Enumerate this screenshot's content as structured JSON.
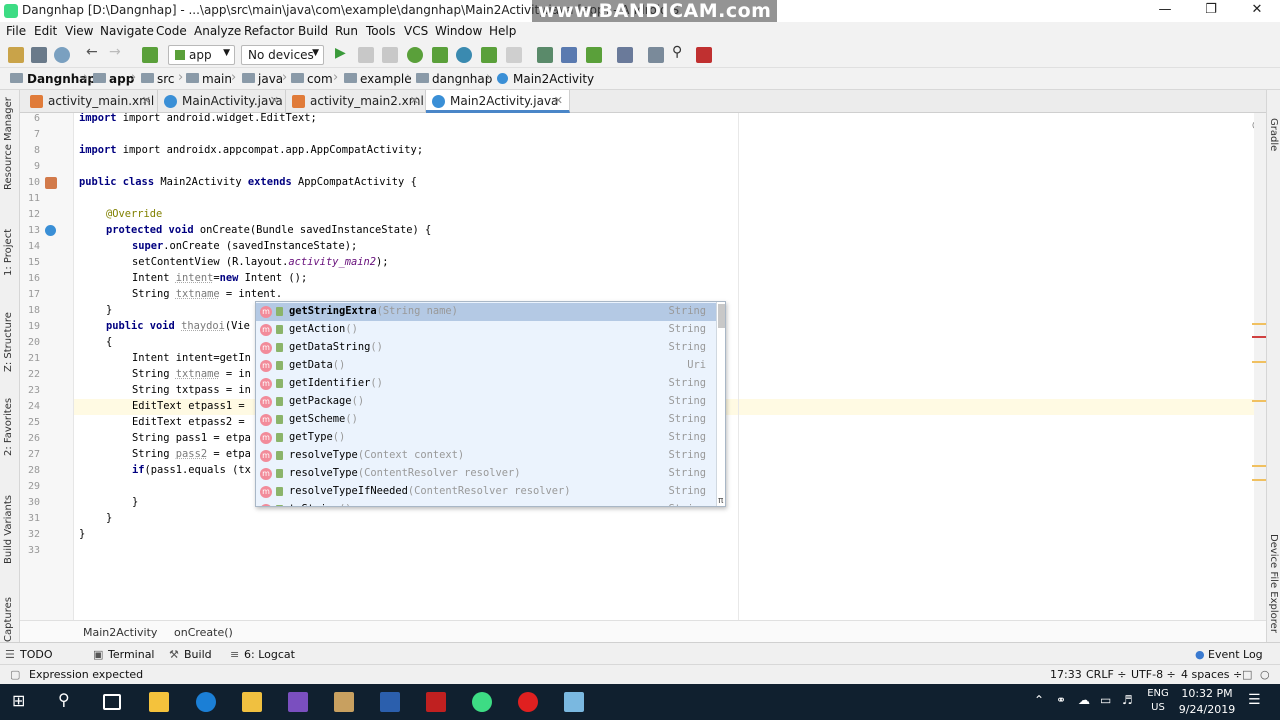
{
  "window": {
    "title": "Dangnhap [D:\\Dangnhap] - ...\\app\\src\\main\\java\\com\\example\\dangnhap\\Main2Activity.java [app] - Android S",
    "watermark": "www.BANDICAM.com",
    "minimize": "—",
    "maximize": "❐",
    "close": "✕"
  },
  "menu": [
    "File",
    "Edit",
    "View",
    "Navigate",
    "Code",
    "Analyze",
    "Refactor",
    "Build",
    "Run",
    "Tools",
    "VCS",
    "Window",
    "Help"
  ],
  "toolbar": {
    "module": "app",
    "device": "No devices"
  },
  "breadcrumbs": [
    "Dangnhap",
    "app",
    "src",
    "main",
    "java",
    "com",
    "example",
    "dangnhap",
    "Main2Activity"
  ],
  "tabs": [
    {
      "label": "activity_main.xml",
      "icon_color": "#e07b39"
    },
    {
      "label": "MainActivity.java",
      "icon_color": "#3a8fd6"
    },
    {
      "label": "activity_main2.xml",
      "icon_color": "#e07b39"
    },
    {
      "label": "Main2Activity.java",
      "icon_color": "#3a8fd6"
    }
  ],
  "left_panels": [
    "Resource Manager",
    "1: Project",
    "Z: Structure",
    "2: Favorites",
    "Build Variants",
    "Captures"
  ],
  "right_panels": [
    "Gradle",
    "Device File Explorer"
  ],
  "code": {
    "line_numbers": [
      "6",
      "7",
      "8",
      "9",
      "10",
      "11",
      "12",
      "13",
      "14",
      "15",
      "16",
      "17",
      "18",
      "19",
      "20",
      "21",
      "22",
      "23",
      "24",
      "25",
      "26",
      "27",
      "28",
      "29",
      "30",
      "31",
      "32",
      "33"
    ],
    "l6": "import android.widget.EditText;",
    "l8": "import androidx.appcompat.app.AppCompatActivity;",
    "l10a": "public class ",
    "l10b": "Main2Activity ",
    "l10c": "extends ",
    "l10d": "AppCompatActivity {",
    "l12": "@Override",
    "l13a": "protected void ",
    "l13b": "onCreate(Bundle savedInstanceState) {",
    "l14a": "super",
    "l14b": ".onCreate (savedInstanceState);",
    "l15a": "setContentView (R.layout.",
    "l15b": "activity_main2",
    "l15c": ");",
    "l16a": "Intent ",
    "l16b": "intent",
    "l16c": "=",
    "l16d": "new ",
    "l16e": "Intent ();",
    "l17a": "String ",
    "l17b": "txtname",
    "l17c": " = intent.",
    "l18": "}",
    "l19a": "public void ",
    "l19b": "thaydoi",
    "l19c": "(Vie",
    "l20": "{",
    "l21": "Intent intent=getIn",
    "l22a": "String ",
    "l22b": "txtname",
    "l22c": " = in",
    "l23": "String txtpass = in",
    "l24": "EditText etpass1 = ",
    "l25": "EditText etpass2 = ",
    "l26": "String pass1 = etpa",
    "l27a": "String ",
    "l27b": "pass2",
    "l27c": " = etpa",
    "l28a": "if",
    "l28b": "(pass1.equals (tx",
    "l30": "}",
    "l31": "}",
    "l32": "}"
  },
  "completion": [
    {
      "name": "getStringExtra",
      "params": "(String name)",
      "type": "String"
    },
    {
      "name": "getAction",
      "params": "()",
      "type": "String"
    },
    {
      "name": "getDataString",
      "params": "()",
      "type": "String"
    },
    {
      "name": "getData",
      "params": "()",
      "type": "Uri"
    },
    {
      "name": "getIdentifier",
      "params": "()",
      "type": "String"
    },
    {
      "name": "getPackage",
      "params": "()",
      "type": "String"
    },
    {
      "name": "getScheme",
      "params": "()",
      "type": "String"
    },
    {
      "name": "getType",
      "params": "()",
      "type": "String"
    },
    {
      "name": "resolveType",
      "params": "(Context context)",
      "type": "String"
    },
    {
      "name": "resolveType",
      "params": "(ContentResolver resolver)",
      "type": "String"
    },
    {
      "name": "resolveTypeIfNeeded",
      "params": "(ContentResolver resolver)",
      "type": "String"
    },
    {
      "name": "toString",
      "params": "()",
      "type": "String"
    }
  ],
  "completion_pi": "π",
  "code_breadcrumb": [
    "Main2Activity",
    "onCreate()"
  ],
  "bottom_tools": [
    "TODO",
    "Terminal",
    "Build",
    "6: Logcat"
  ],
  "event_log": "Event Log",
  "status": {
    "message": "Expression expected",
    "position": "17:33",
    "line_sep": "CRLF ÷",
    "encoding": "UTF-8 ÷",
    "indent": "4 spaces ÷"
  },
  "taskbar": {
    "lang": "ENG",
    "region": "US",
    "time": "10:32 PM",
    "date": "9/24/2019"
  },
  "colors": {
    "accent": "#4a86c8",
    "android_green": "#3ddc84",
    "taskbar": "#10202f"
  }
}
